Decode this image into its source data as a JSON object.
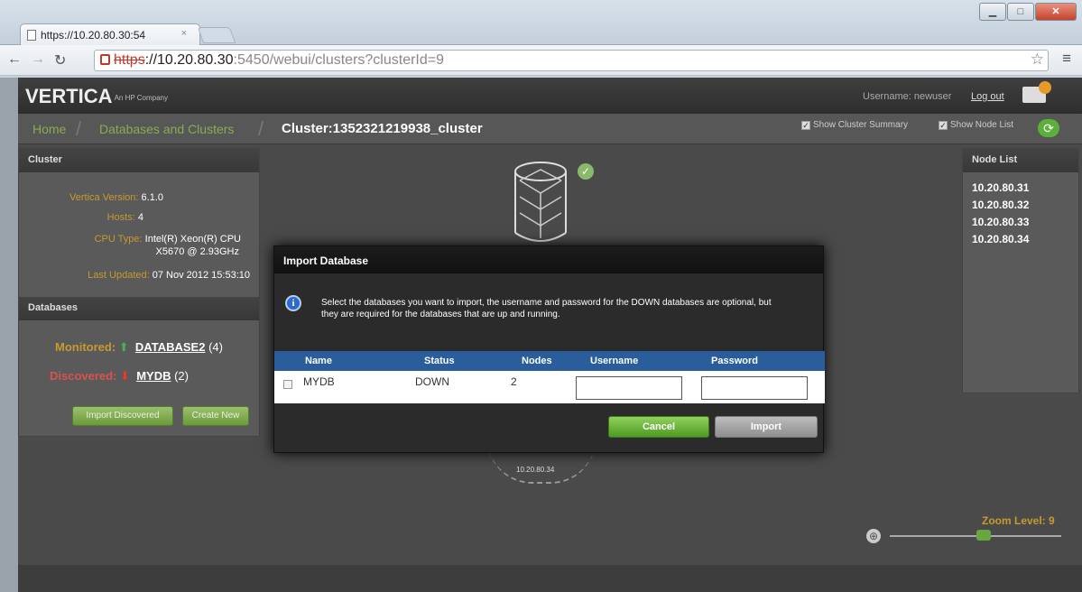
{
  "browser": {
    "tab_title": "https://10.20.80.30:54",
    "tab_close": "×",
    "url_scheme": "https",
    "url_host": "://10.20.80.30",
    "url_rest": ":5450/webui/clusters?clusterId=9",
    "window_controls": [
      "minimize",
      "maximize",
      "close"
    ]
  },
  "header": {
    "logo": "VERTICA",
    "logo_sub": "An HP Company",
    "username_label": "Username: newuser",
    "logout": "Log out"
  },
  "breadcrumb": {
    "home": "Home",
    "databases": "Databases and Clusters",
    "title": "Cluster:1352321219938_cluster",
    "show_summary": "Show Cluster Summary",
    "show_node_list": "Show Node List"
  },
  "cluster_panel": {
    "heading": "Cluster",
    "version_key": "Vertica Version:",
    "version_val": "6.1.0",
    "hosts_key": "Hosts:",
    "hosts_val": "4",
    "cpu_key": "CPU Type:",
    "cpu_val1": "Intel(R) Xeon(R) CPU",
    "cpu_val2": "X5670 @ 2.93GHz",
    "updated_key": "Last Updated:",
    "updated_val": "07 Nov 2012 15:53:10",
    "db_heading": "Databases",
    "monitored_key": "Monitored:",
    "monitored_db": "DATABASE2",
    "monitored_count": "(4)",
    "discovered_key": "Discovered:",
    "discovered_db": "MYDB",
    "discovered_count": "(2)",
    "import_btn": "Import Discovered",
    "create_btn": "Create New"
  },
  "node_list": {
    "heading": "Node List",
    "nodes": [
      "10.20.80.31",
      "10.20.80.32",
      "10.20.80.33",
      "10.20.80.34"
    ]
  },
  "canvas": {
    "node_label": "10.20.80.34",
    "zoom_label": "Zoom Level: 9"
  },
  "dialog": {
    "title": "Import Database",
    "message": "Select the databases you want to import, the username and password for the DOWN databases are optional, but they are required for the databases that are up and running.",
    "columns": [
      "Name",
      "Status",
      "Nodes",
      "Username",
      "Password"
    ],
    "rows": [
      {
        "name": "MYDB",
        "status": "DOWN",
        "nodes": "2",
        "username": "",
        "password": ""
      }
    ],
    "cancel": "Cancel",
    "import": "Import"
  }
}
